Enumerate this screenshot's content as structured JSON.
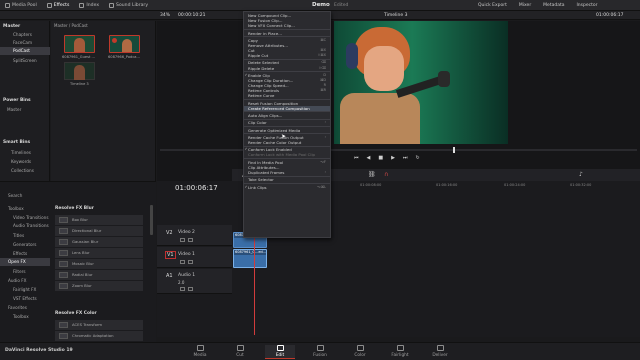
{
  "topbar": {
    "items": [
      {
        "label": "Media Pool",
        "icon": "media-pool-icon"
      },
      {
        "label": "Effects",
        "icon": "effects-icon"
      },
      {
        "label": "Index",
        "icon": "index-icon"
      },
      {
        "label": "Sound Library",
        "icon": "sound-library-icon"
      }
    ],
    "project": "Demo",
    "status": "Edited",
    "right_items": [
      {
        "label": "Quick Export"
      },
      {
        "label": "Mixer"
      },
      {
        "label": "Metadata"
      },
      {
        "label": "Inspector"
      }
    ]
  },
  "bar2": {
    "zoom": "34%",
    "timecode": "00:00:10:21",
    "timeline_name": "Timeline 3",
    "viewer_timecode": "01:00:06:17"
  },
  "media_pool": {
    "bins": [
      "Master",
      "Chapters",
      "FaceCam",
      "PodCast",
      "SplitScreen"
    ],
    "selected_bin": "PodCast",
    "path": "Master / PodCast",
    "clips": [
      {
        "name": "6087961_Guest ..."
      },
      {
        "name": "6087966_Podca..."
      },
      {
        "name": "Timeline 3"
      }
    ],
    "power_bins_label": "Power Bins",
    "power_bins": [
      "Master"
    ],
    "smart_bins_label": "Smart Bins",
    "smart_bins": [
      "Timelines",
      "Keywords",
      "Collections"
    ]
  },
  "effects": {
    "search_label": "Search",
    "tree": [
      "Toolbox",
      "Video Transitions",
      "Audio Transitions",
      "Titles",
      "Generators",
      "Effects",
      "Open FX",
      "Filters",
      "Audio FX",
      "Fairlight FX",
      "VST Effects",
      "Favorites",
      "Toolbox"
    ],
    "selected": "Open FX",
    "groups": [
      {
        "title": "Resolve FX Blur",
        "items": [
          "Box Blur",
          "Directional Blur",
          "Gaussian Blur",
          "Lens Blur",
          "Mosaic Blur",
          "Radial Blur",
          "Zoom Blur"
        ]
      },
      {
        "title": "Resolve FX Color",
        "items": [
          "ACES Transform",
          "Chromatic Adaptation"
        ]
      }
    ]
  },
  "context_menu": {
    "items": [
      {
        "label": "New Compound Clip...",
        "type": "item"
      },
      {
        "label": "New Fusion Clip...",
        "type": "item"
      },
      {
        "label": "New VFX Connect Clip...",
        "type": "item"
      },
      {
        "type": "sep"
      },
      {
        "label": "Render in Place...",
        "type": "item"
      },
      {
        "type": "sep"
      },
      {
        "label": "Copy",
        "shortcut": "⌘C",
        "type": "item"
      },
      {
        "label": "Remove Attributes...",
        "type": "item"
      },
      {
        "label": "Cut",
        "shortcut": "⌘X",
        "type": "item"
      },
      {
        "label": "Ripple Cut",
        "shortcut": "⇧⌘X",
        "type": "item"
      },
      {
        "type": "sep"
      },
      {
        "label": "Delete Selected",
        "shortcut": "⌫",
        "type": "item"
      },
      {
        "label": "Ripple Delete",
        "shortcut": "⇧⌫",
        "type": "item"
      },
      {
        "type": "sep"
      },
      {
        "label": "Enable Clip",
        "shortcut": "D",
        "type": "check"
      },
      {
        "label": "Change Clip Duration...",
        "shortcut": "⌘D",
        "type": "item"
      },
      {
        "label": "Change Clip Speed...",
        "shortcut": "R",
        "type": "item"
      },
      {
        "label": "Retime Controls",
        "shortcut": "⌘R",
        "type": "item"
      },
      {
        "label": "Retime Curve",
        "type": "item"
      },
      {
        "type": "sep"
      },
      {
        "label": "Reset Fusion Composition",
        "type": "item"
      },
      {
        "label": "Create Referenced Composition",
        "type": "highlight"
      },
      {
        "type": "sep"
      },
      {
        "label": "Auto Align Clips...",
        "type": "item"
      },
      {
        "type": "sep"
      },
      {
        "label": "Clip Color",
        "type": "submenu"
      },
      {
        "type": "sep"
      },
      {
        "label": "Generate Optimized Media",
        "type": "item"
      },
      {
        "type": "sep"
      },
      {
        "label": "Render Cache Fusion Output",
        "type": "submenu"
      },
      {
        "label": "Render Cache Color Output",
        "type": "item"
      },
      {
        "type": "sep"
      },
      {
        "label": "Conform Lock Enabled",
        "type": "check"
      },
      {
        "label": "Conform Lock with Media Pool Clip",
        "type": "disabled"
      },
      {
        "type": "sep"
      },
      {
        "label": "Find In Media Pool",
        "shortcut": "⌥F",
        "type": "item"
      },
      {
        "label": "Clip Attributes...",
        "type": "item"
      },
      {
        "label": "Duplicated Frames",
        "type": "submenu"
      },
      {
        "type": "sep"
      },
      {
        "label": "Take Selector",
        "type": "item"
      },
      {
        "type": "sep"
      },
      {
        "label": "Link Clips",
        "shortcut": "⌥⌘L",
        "type": "check"
      }
    ]
  },
  "timeline": {
    "timecode": "01:00:06:17",
    "ruler": [
      "01:00:00:00",
      "01:00:08:00",
      "01:00:16:00",
      "01:00:24:00",
      "01:00:32:00",
      "01:00:40:00"
    ],
    "tracks": [
      {
        "id": "V2",
        "name": "Video 2",
        "clip": "6087966_Po..."
      },
      {
        "id": "V1",
        "name": "Video 1",
        "clip": "6087961_G...ed..."
      },
      {
        "id": "A1",
        "name": "Audio 1",
        "level": "2.0"
      }
    ]
  },
  "pages": [
    {
      "label": "Media",
      "icon": "media-page-icon"
    },
    {
      "label": "Cut",
      "icon": "cut-page-icon"
    },
    {
      "label": "Edit",
      "icon": "edit-page-icon"
    },
    {
      "label": "Fusion",
      "icon": "fusion-page-icon"
    },
    {
      "label": "Color",
      "icon": "color-page-icon"
    },
    {
      "label": "Fairlight",
      "icon": "fairlight-page-icon"
    },
    {
      "label": "Deliver",
      "icon": "deliver-page-icon"
    }
  ],
  "active_page": "Edit",
  "app_name": "DaVinci Resolve Studio 19",
  "colors": {
    "accent": "#c0392b",
    "clip_blue": "#3a6ea8",
    "playhead": "#d23c3c",
    "menu_highlight": "#444a55"
  }
}
